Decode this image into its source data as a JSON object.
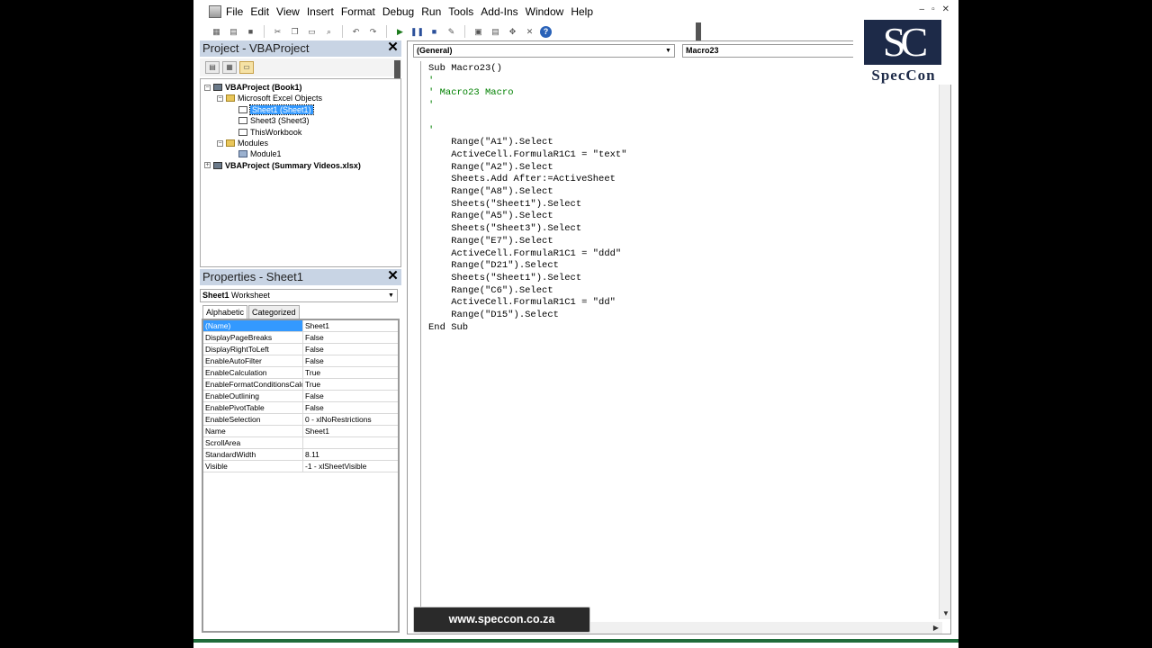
{
  "menu": [
    "File",
    "Edit",
    "View",
    "Insert",
    "Format",
    "Debug",
    "Run",
    "Tools",
    "Add-Ins",
    "Window",
    "Help"
  ],
  "window_controls": [
    "–",
    "▫",
    "✕"
  ],
  "project": {
    "title": "Project - VBAProject",
    "tree": [
      {
        "label": "VBAProject (Book1)",
        "level": 0,
        "bold": true,
        "icon": "project-icon",
        "expander": "-"
      },
      {
        "label": "Microsoft Excel Objects",
        "level": 1,
        "bold": false,
        "icon": "folder-icon",
        "expander": "-"
      },
      {
        "label": "Sheet1 (Sheet1)",
        "level": 2,
        "bold": false,
        "icon": "sheet-icon",
        "selected": true
      },
      {
        "label": "Sheet3 (Sheet3)",
        "level": 2,
        "bold": false,
        "icon": "sheet-icon"
      },
      {
        "label": "ThisWorkbook",
        "level": 2,
        "bold": false,
        "icon": "workbook-icon"
      },
      {
        "label": "Modules",
        "level": 1,
        "bold": false,
        "icon": "folder-icon",
        "expander": "-"
      },
      {
        "label": "Module1",
        "level": 2,
        "bold": false,
        "icon": "module-icon"
      },
      {
        "label": "VBAProject (Summary Videos.xlsx)",
        "level": 0,
        "bold": true,
        "icon": "project-icon",
        "expander": "+"
      }
    ]
  },
  "properties": {
    "title": "Properties - Sheet1",
    "object_name": "Sheet1",
    "object_type": "Worksheet",
    "tabs": [
      "Alphabetic",
      "Categorized"
    ],
    "rows": [
      {
        "name": "(Name)",
        "value": "Sheet1"
      },
      {
        "name": "DisplayPageBreaks",
        "value": "False"
      },
      {
        "name": "DisplayRightToLeft",
        "value": "False"
      },
      {
        "name": "EnableAutoFilter",
        "value": "False"
      },
      {
        "name": "EnableCalculation",
        "value": "True"
      },
      {
        "name": "EnableFormatConditionsCalc",
        "value": "True"
      },
      {
        "name": "EnableOutlining",
        "value": "False"
      },
      {
        "name": "EnablePivotTable",
        "value": "False"
      },
      {
        "name": "EnableSelection",
        "value": "0 - xlNoRestrictions"
      },
      {
        "name": "Name",
        "value": "Sheet1"
      },
      {
        "name": "ScrollArea",
        "value": ""
      },
      {
        "name": "StandardWidth",
        "value": "8.11"
      },
      {
        "name": "Visible",
        "value": "-1 - xlSheetVisible"
      }
    ]
  },
  "code": {
    "object_combo": "(General)",
    "procedure_combo": "Macro23",
    "lines": [
      {
        "text": "Sub Macro23()",
        "type": "code"
      },
      {
        "text": "'",
        "type": "comment"
      },
      {
        "text": "' Macro23 Macro",
        "type": "comment"
      },
      {
        "text": "'",
        "type": "comment"
      },
      {
        "text": "",
        "type": "code"
      },
      {
        "text": "'",
        "type": "comment"
      },
      {
        "text": "    Range(\"A1\").Select",
        "type": "code"
      },
      {
        "text": "    ActiveCell.FormulaR1C1 = \"text\"",
        "type": "code"
      },
      {
        "text": "    Range(\"A2\").Select",
        "type": "code"
      },
      {
        "text": "    Sheets.Add After:=ActiveSheet",
        "type": "code"
      },
      {
        "text": "    Range(\"A8\").Select",
        "type": "code"
      },
      {
        "text": "    Sheets(\"Sheet1\").Select",
        "type": "code"
      },
      {
        "text": "    Range(\"A5\").Select",
        "type": "code"
      },
      {
        "text": "    Sheets(\"Sheet3\").Select",
        "type": "code"
      },
      {
        "text": "    Range(\"E7\").Select",
        "type": "code"
      },
      {
        "text": "    ActiveCell.FormulaR1C1 = \"ddd\"",
        "type": "code"
      },
      {
        "text": "    Range(\"D21\").Select",
        "type": "code"
      },
      {
        "text": "    Sheets(\"Sheet1\").Select",
        "type": "code"
      },
      {
        "text": "    Range(\"C6\").Select",
        "type": "code"
      },
      {
        "text": "    ActiveCell.FormulaR1C1 = \"dd\"",
        "type": "code"
      },
      {
        "text": "    Range(\"D15\").Select",
        "type": "code"
      },
      {
        "text": "End Sub",
        "type": "code"
      }
    ]
  },
  "watermark": "www.speccon.co.za",
  "logo": {
    "monogram": "SC",
    "name": "SpecCon"
  },
  "colors": {
    "selection": "#3399ff",
    "comment": "#008000",
    "panel_title": "#c8d4e4",
    "logo": "#1d2a48"
  }
}
